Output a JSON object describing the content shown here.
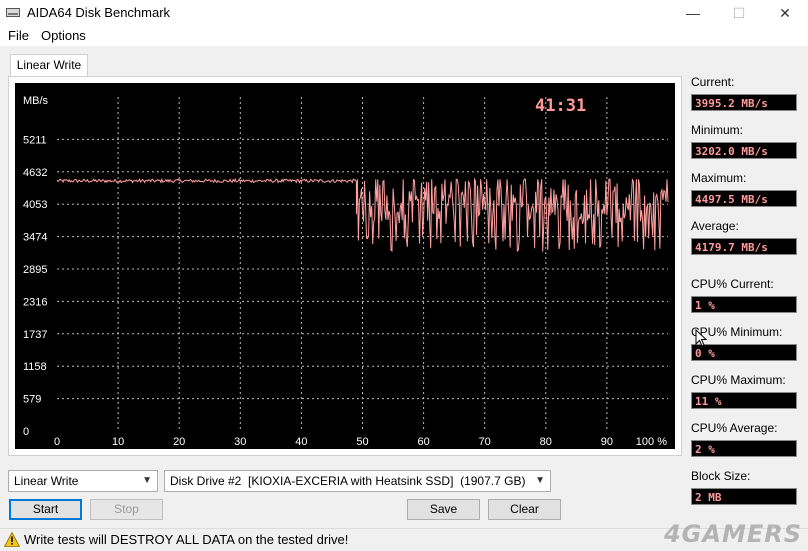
{
  "window": {
    "title": "AIDA64 Disk Benchmark",
    "minimize": "—",
    "maximize": "☐",
    "close": "✕"
  },
  "menu": {
    "file": "File",
    "options": "Options"
  },
  "tab": {
    "label": "Linear Write"
  },
  "chart_data": {
    "type": "line",
    "ylabel": "MB/s",
    "timer": "41:31",
    "yticks": [
      "5211",
      "4632",
      "4053",
      "3474",
      "2895",
      "2316",
      "1737",
      "1158",
      "579",
      "0"
    ],
    "ylim": [
      0,
      5790
    ],
    "xticks": [
      "0",
      "10",
      "20",
      "30",
      "40",
      "50",
      "60",
      "70",
      "80",
      "90",
      "100 %"
    ],
    "xlim": [
      0,
      100
    ],
    "grid": true,
    "line_color": "#ffa0a0",
    "series": [
      {
        "segment": "stable",
        "x_range": [
          0,
          49
        ],
        "mean": 4470,
        "noise": 60
      },
      {
        "segment": "fluctuating",
        "x_range": [
          49,
          100
        ],
        "mean": 4150,
        "noise": 450,
        "min": 3202.0,
        "max": 4497.5
      }
    ]
  },
  "stats": {
    "current_label": "Current:",
    "current": "3995.2 MB/s",
    "minimum_label": "Minimum:",
    "minimum": "3202.0 MB/s",
    "maximum_label": "Maximum:",
    "maximum": "4497.5 MB/s",
    "average_label": "Average:",
    "average": "4179.7 MB/s",
    "cpu_current_label": "CPU% Current:",
    "cpu_current": "1 %",
    "cpu_minimum_label": "CPU% Minimum:",
    "cpu_minimum": "0 %",
    "cpu_maximum_label": "CPU% Maximum:",
    "cpu_maximum": "11 %",
    "cpu_average_label": "CPU% Average:",
    "cpu_average": "2 %",
    "block_size_label": "Block Size:",
    "block_size": "2 MB"
  },
  "controls": {
    "test_select": "Linear Write",
    "drive_select": "Disk Drive #2  [KIOXIA-EXCERIA with Heatsink SSD]  (1907.7 GB)",
    "start": "Start",
    "stop": "Stop",
    "save": "Save",
    "clear": "Clear"
  },
  "status": {
    "warning": "Write tests will DESTROY ALL DATA on the tested drive!"
  },
  "watermark": "4GAMERS"
}
